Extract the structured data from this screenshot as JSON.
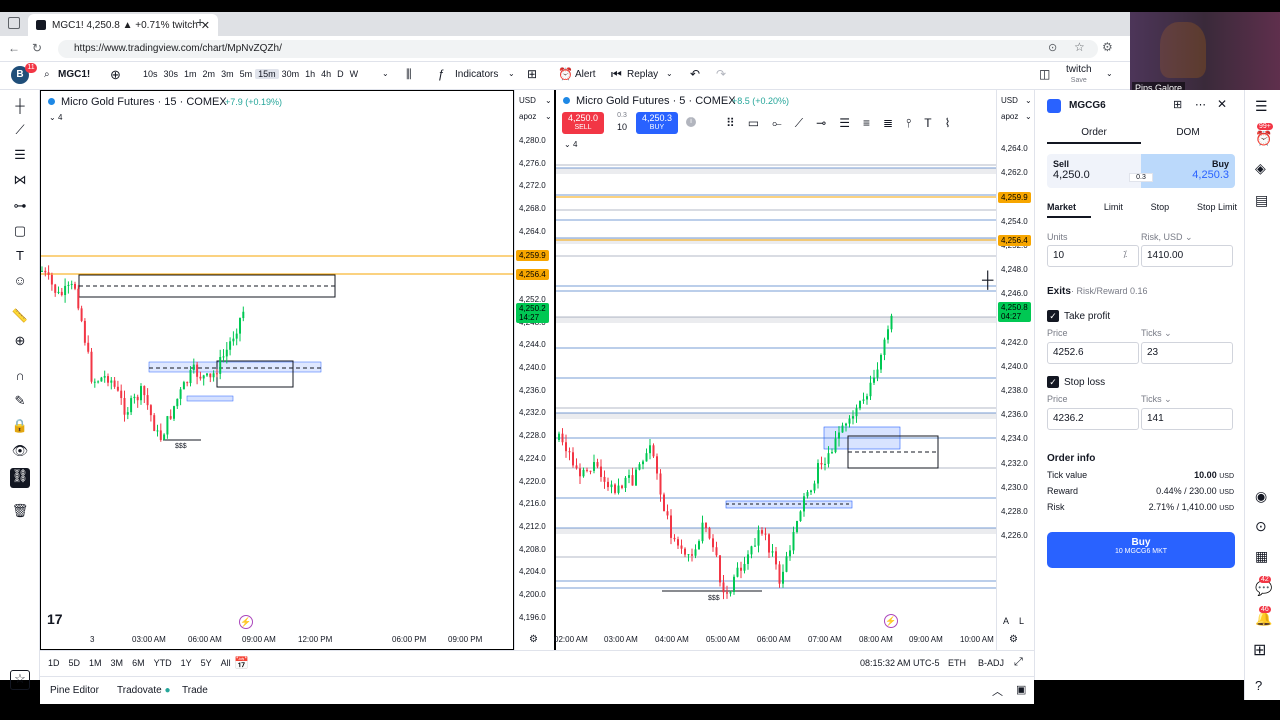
{
  "browser": {
    "tab_title": "MGC1! 4,250.8 ▲ +0.71% twitch",
    "url": "https://www.tradingview.com/chart/MpNvZQZh/"
  },
  "toolbar": {
    "avatar_letter": "B",
    "avatar_badge": "11",
    "symbol": "MGC1!",
    "intervals": [
      "10s",
      "30s",
      "1m",
      "2m",
      "3m",
      "5m",
      "15m",
      "30m",
      "1h",
      "4h",
      "D",
      "W"
    ],
    "indicators": "Indicators",
    "alert": "Alert",
    "replay": "Replay",
    "twitch": "twitch",
    "twitch_sub": "Save"
  },
  "chart_left": {
    "title": "Micro Gold Futures · 15 · COMEX",
    "change": "+7.9 (+0.19%)",
    "count": "4",
    "currency": "USD",
    "mode": "apoz",
    "price_ticks": [
      "4,280.0",
      "4,276.0",
      "4,272.0",
      "4,268.0",
      "4,264.0",
      "4,252.0",
      "4,248.0",
      "4,244.0",
      "4,240.0",
      "4,236.0",
      "4,232.0",
      "4,228.0",
      "4,224.0",
      "4,220.0",
      "4,216.0",
      "4,212.0",
      "4,208.0",
      "4,204.0",
      "4,200.0",
      "4,196.0"
    ],
    "tag_1": "4,259.9",
    "tag_2": "4,256.4",
    "tag_price": "4,250.2",
    "tag_time": "14:27",
    "time_ticks": [
      "3",
      "03:00 AM",
      "06:00 AM",
      "09:00 AM",
      "12:00 PM",
      "06:00 PM",
      "09:00 PM"
    ],
    "ss_label": "$$$"
  },
  "chart_right": {
    "title": "Micro Gold Futures · 5 · COMEX",
    "change": "+8.5 (+0.20%)",
    "count": "4",
    "currency": "USD",
    "mode": "apoz",
    "sell_price": "4,250.0",
    "sell_label": "SELL",
    "spread": "0.3",
    "qty": "10",
    "buy_price": "4,250.3",
    "buy_label": "BUY",
    "price_ticks": [
      "4,264.0",
      "4,262.0",
      "4,258.0",
      "4,254.0",
      "4,252.0",
      "4,248.0",
      "4,246.0",
      "4,244.0",
      "4,242.0",
      "4,240.0",
      "4,238.0",
      "4,236.0",
      "4,234.0",
      "4,232.0",
      "4,230.0",
      "4,228.0",
      "4,226.0"
    ],
    "tag_1": "4,259.9",
    "tag_2": "4,256.4",
    "tag_price": "4,250.8",
    "tag_time": "04:27",
    "time_ticks": [
      "02:00 AM",
      "03:00 AM",
      "04:00 AM",
      "05:00 AM",
      "06:00 AM",
      "07:00 AM",
      "08:00 AM",
      "09:00 AM",
      "10:00 AM"
    ],
    "ss_label": "$$$",
    "axis_a": "A",
    "axis_l": "L"
  },
  "bottom": {
    "ranges": [
      "1D",
      "5D",
      "1M",
      "3M",
      "6M",
      "YTD",
      "1Y",
      "5Y",
      "All"
    ],
    "clock": "08:15:32 AM UTC-5",
    "eth": "ETH",
    "badj": "B-ADJ"
  },
  "footer": {
    "pine": "Pine Editor",
    "tradovate": "Tradovate",
    "trade": "Trade"
  },
  "panel": {
    "symbol": "MGCG6",
    "tab_order": "Order",
    "tab_dom": "DOM",
    "sell_label": "Sell",
    "sell_price": "4,250.0",
    "spread": "0.3",
    "buy_label": "Buy",
    "buy_price": "4,250.3",
    "types": [
      "Market",
      "Limit",
      "Stop",
      "Stop Limit"
    ],
    "units_label": "Units",
    "units_value": "10",
    "risk_label": "Risk, USD",
    "risk_value": "1410.00",
    "exits_label": "Exits",
    "exits_rr": "Risk/Reward 0.16",
    "tp_label": "Take profit",
    "tp_price_label": "Price",
    "tp_price": "4252.6",
    "tp_ticks_label": "Ticks",
    "tp_ticks": "23",
    "sl_label": "Stop loss",
    "sl_price_label": "Price",
    "sl_price": "4236.2",
    "sl_ticks_label": "Ticks",
    "sl_ticks": "141",
    "info_label": "Order info",
    "tick_value_label": "Tick value",
    "tick_value": "10.00",
    "reward_label": "Reward",
    "reward_value": "0.44% / 230.00",
    "risk_row_label": "Risk",
    "risk_row_value": "2.71% / 1,410.00",
    "usd": "USD",
    "buy_button": "Buy",
    "buy_button_sub": "10 MGCG6 MKT"
  },
  "right_strip": {
    "badge_1": "99+",
    "badge_2": "42",
    "badge_3": "46"
  },
  "webcam": {
    "name": "Pips Galore"
  },
  "colors": {
    "green": "#26a69a",
    "bright_green": "#00c853",
    "red": "#f23645",
    "blue": "#2962ff",
    "orange": "#f7a600"
  }
}
